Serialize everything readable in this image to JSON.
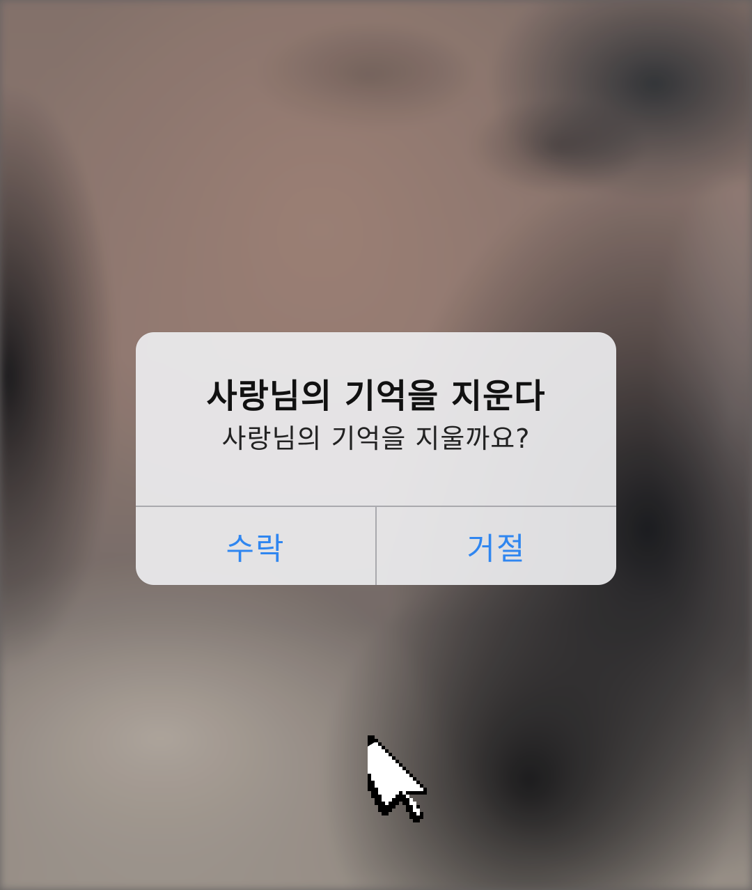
{
  "background": {
    "description_icon": "blurred-photo"
  },
  "alert": {
    "title": "사랑님의 기억을 지운다",
    "message": "사랑님의 기억을 지울까요?",
    "buttons": {
      "accept_label": "수락",
      "decline_label": "거절"
    }
  },
  "colors": {
    "button_text": "#2f86f0",
    "title_text": "#111111",
    "dialog_background": "#ececee"
  },
  "cursor": {
    "icon": "pixel-arrow-cursor-icon"
  }
}
